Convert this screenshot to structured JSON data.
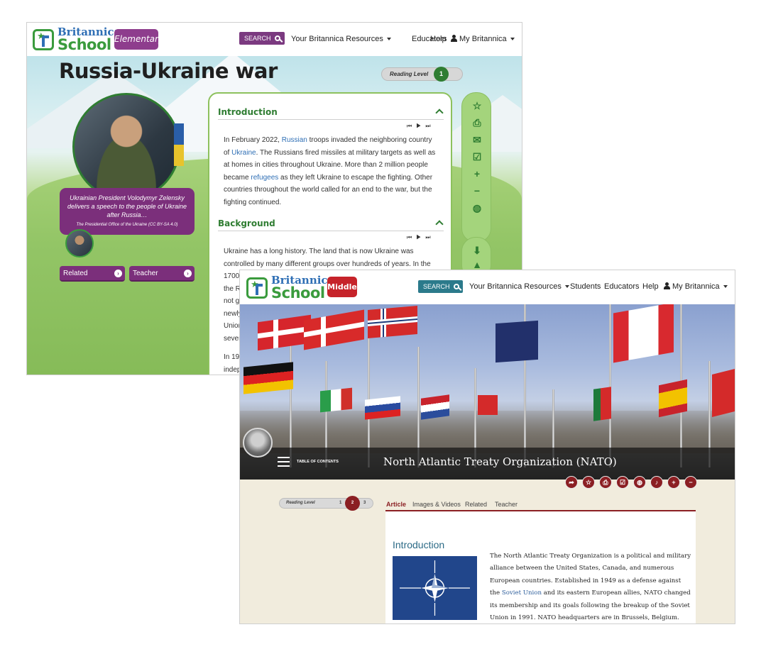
{
  "elementary": {
    "logo": {
      "brand": "Britannica",
      "product": "School",
      "badge": "Elementary"
    },
    "nav": {
      "search_label": "SEARCH",
      "resources": "Your Britannica Resources",
      "educators": "Educators",
      "help": "Help",
      "account": "My Britannica"
    },
    "title": "Russia-Ukraine war",
    "reading_level": {
      "label": "Reading Level",
      "value": "1"
    },
    "caption": {
      "text": "Ukrainian President Volodymyr Zelensky delivers a speech to the people of Ukraine after Russia…",
      "credit": "The Presidential Office of the Ukraine (CC BY-SA 4.0)"
    },
    "buttons": {
      "related": "Related",
      "teacher": "Teacher"
    },
    "sections": [
      {
        "heading": "Introduction",
        "text_parts": [
          "In February 2022, ",
          "Russian",
          " troops invaded the neighboring country of ",
          "Ukraine",
          ". The Russians fired missiles at military targets as well as at homes in cities throughout Ukraine. More than 2 million people became ",
          "refugees",
          " as they left Ukraine to escape the fighting. Other countries throughout the world called for an end to the war, but the fighting continued."
        ]
      },
      {
        "heading": "Background",
        "lines": [
          "Ukraine has a long history. The land that is now Ukraine was",
          "controlled by many different groups over hundreds of years. In the",
          "1700",
          "the R",
          "not g",
          "newly",
          "Union",
          "sever"
        ],
        "next_line": "In 19",
        "next_line2": "indep"
      }
    ],
    "audio_controls": [
      "⏮",
      "▶",
      "⏭"
    ],
    "tools": [
      "star-icon",
      "print-icon",
      "email-icon",
      "checklist-icon",
      "zoom-in-icon",
      "zoom-out-icon",
      "globe-icon"
    ]
  },
  "middle": {
    "logo": {
      "brand": "Britannica",
      "product": "School",
      "badge": "Middle"
    },
    "nav": {
      "search_label": "SEARCH",
      "resources": "Your Britannica Resources",
      "students": "Students",
      "educators": "Educators",
      "help": "Help",
      "account": "My Britannica"
    },
    "toc_label": "TABLE OF CONTENTS",
    "title": "North Atlantic Treaty Organization (NATO)",
    "tools": [
      "share-icon",
      "star-icon",
      "print-icon",
      "checklist-icon",
      "globe-icon",
      "audio-icon",
      "zoom-in-icon",
      "zoom-out-icon"
    ],
    "reading_level": {
      "label": "Reading Level",
      "levels": [
        "1",
        "2",
        "3"
      ],
      "selected": "2"
    },
    "tabs": [
      "Article",
      "Images & Videos",
      "Related",
      "Teacher"
    ],
    "active_tab": "Article",
    "article": {
      "heading": "Introduction",
      "text_parts": [
        "The North Atlantic Treaty Organization is a political and military alliance between the United States, Canada, and numerous European countries. Established in 1949 as a defense against the ",
        "Soviet Union",
        " and its eastern European allies, NATO changed its membership and its goals following the breakup of the Soviet Union in 1991. NATO headquarters are in Brussels, Belgium."
      ]
    },
    "colors": {
      "accent": "#8b1f23",
      "search": "#2b7a8b",
      "nato_blue": "#21468b"
    }
  },
  "colors": {
    "elementary_purple": "#7b2f7b",
    "elementary_green": "#2f7d32"
  }
}
